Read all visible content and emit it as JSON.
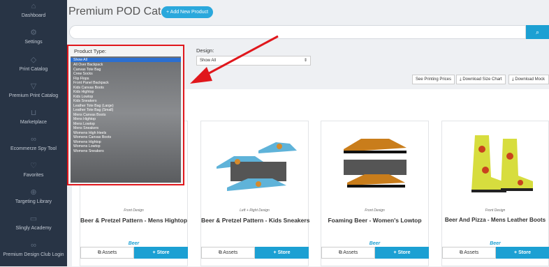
{
  "sidebar": {
    "items": [
      {
        "label": "Dashboard",
        "icon": "home-icon"
      },
      {
        "label": "Settings",
        "icon": "gear-icon"
      },
      {
        "label": "Print Catalog",
        "icon": "tag-icon"
      },
      {
        "label": "Premium Print Catalog",
        "icon": "shirt-icon"
      },
      {
        "label": "Marketplace",
        "icon": "cart-icon"
      },
      {
        "label": "Ecommerze Spy Tool",
        "icon": "link-icon"
      },
      {
        "label": "Favorites",
        "icon": "heart-icon"
      },
      {
        "label": "Targeting Library",
        "icon": "target-icon"
      },
      {
        "label": "Slingly Academy",
        "icon": "monitor-icon"
      },
      {
        "label": "Premium Design Club Login",
        "icon": "link-icon"
      }
    ]
  },
  "header": {
    "title": "Premium POD Catalog",
    "add_button": "+ Add New Product"
  },
  "search": {
    "placeholder": "",
    "button_icon": "search-icon"
  },
  "filters": {
    "product_type_label": "Product Type:",
    "design_label": "Design:",
    "design_value": "Show All",
    "product_type_options": [
      "Show All",
      "All Over Backpack",
      "Canvas Tote Bag",
      "Crew Socks",
      "Flip Flops",
      "Front Panel Backpack",
      "Kids Canvas Boots",
      "Kids Hightop",
      "Kids Lowtop",
      "Kids Sneakers",
      "Leather Tote Bag (Large)",
      "Leather Tote Bag (Small)",
      "Mens Canvas Boots",
      "Mens Hightop",
      "Mens Lowtop",
      "Mens Sneakers",
      "Womens High Heels",
      "Womens Canvas Boots",
      "Womens Hightop",
      "Womens Lowtop",
      "Womens Sneakers"
    ],
    "selected": "Show All"
  },
  "toolbar": {
    "printing_prices": "See Printing Prices",
    "size_chart": "Download Size Chart",
    "mockups": "Download Mock"
  },
  "products": [
    {
      "design_label": "Front Design",
      "name": "Beer & Pretzel Pattern - Mens Hightop",
      "brand": "Beer",
      "assets": "Assets",
      "store": "+ Store"
    },
    {
      "design_label": "Left + Right Design",
      "name": "Beer & Pretzel Pattern - Kids Sneakers",
      "brand": "",
      "assets": "Assets",
      "store": "+ Store"
    },
    {
      "design_label": "Front Design",
      "name": "Foaming Beer - Women's Lowtop",
      "brand": "Beer",
      "assets": "Assets",
      "store": "+ Store"
    },
    {
      "design_label": "Front Design",
      "name": "Beer And Pizza - Mens Leather Boots",
      "brand": "Beer",
      "assets": "Assets",
      "store": "+ Store"
    }
  ],
  "colors": {
    "sidebar": "#283445",
    "accent": "#1ca0d3",
    "highlight": "#e0171c"
  }
}
